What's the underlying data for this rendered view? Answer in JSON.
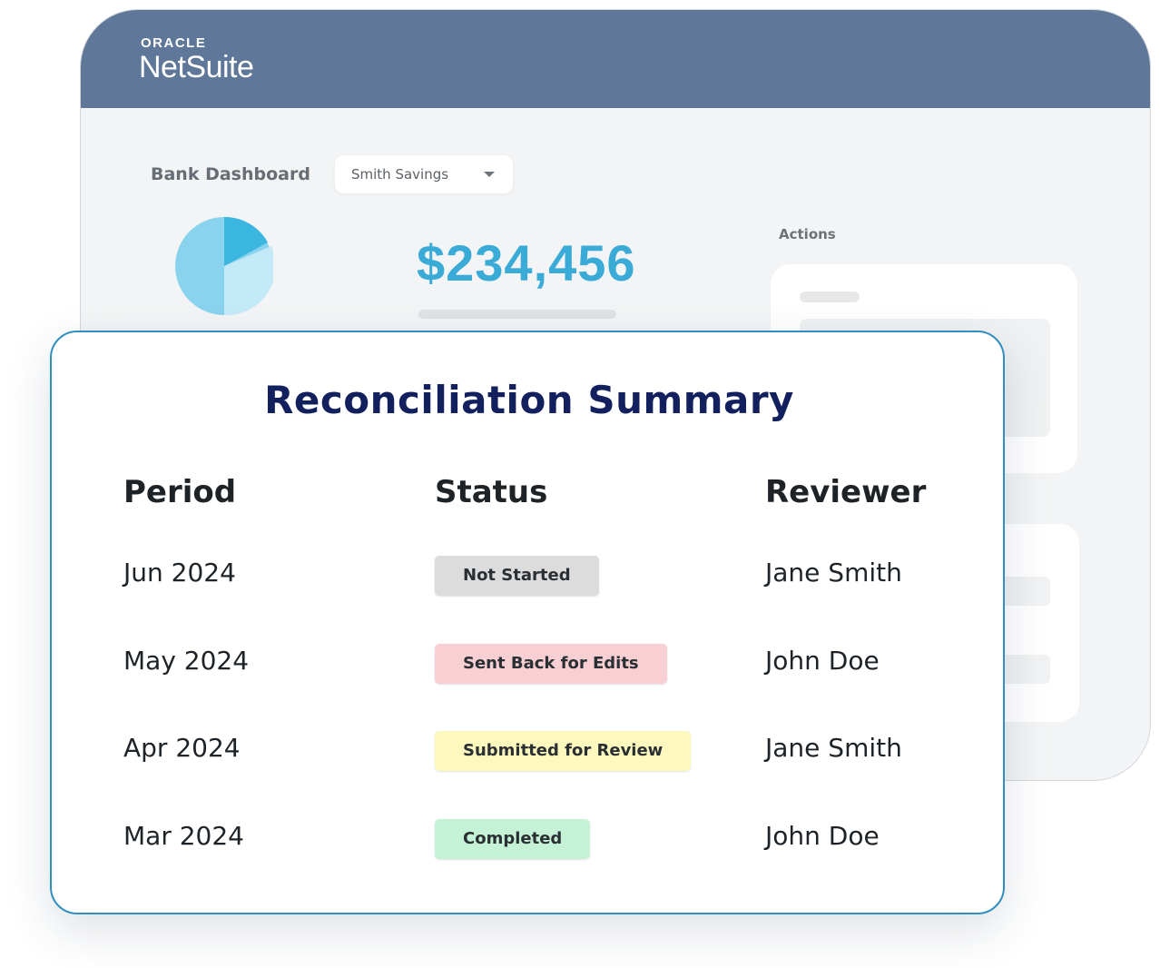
{
  "logo": {
    "brand": "ORACLE",
    "product": "NetSuite"
  },
  "dashboard": {
    "title": "Bank Dashboard",
    "account_select": {
      "value": "Smith Savings"
    },
    "balance": "$234,456",
    "actions_label": "Actions",
    "pie_colors": [
      "#3bb6e0",
      "#8ad3ee",
      "#c4e9f7"
    ]
  },
  "summary": {
    "title": "Reconciliation Summary",
    "columns": {
      "period": "Period",
      "status": "Status",
      "reviewer": "Reviewer"
    },
    "rows": [
      {
        "period": "Jun 2024",
        "status": "Not Started",
        "status_color": "#dcdcdc",
        "reviewer": "Jane Smith"
      },
      {
        "period": "May 2024",
        "status": "Sent Back for Edits",
        "status_color": "#f8cfd3",
        "reviewer": "John Doe"
      },
      {
        "period": "Apr 2024",
        "status": "Submitted for Review",
        "status_color": "#fdf8bd",
        "reviewer": "Jane Smith"
      },
      {
        "period": "Mar 2024",
        "status": "Completed",
        "status_color": "#c5f2d6",
        "reviewer": "John Doe"
      }
    ]
  },
  "colors": {
    "header": "#5f7899",
    "accent_amount": "#3aaad6",
    "title": "#13205e",
    "card_border": "#2f8fbf"
  }
}
